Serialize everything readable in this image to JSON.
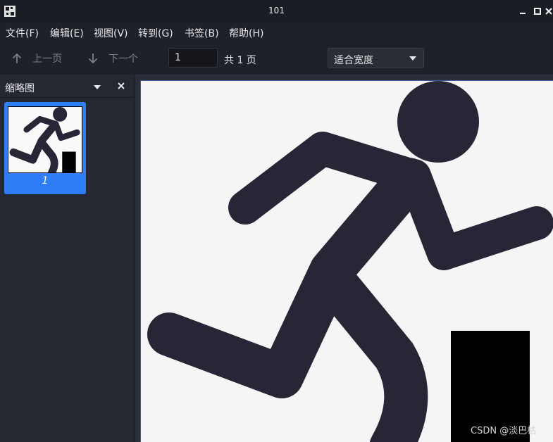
{
  "window": {
    "title": "101"
  },
  "menu": [
    {
      "label": "文件(F)"
    },
    {
      "label": "编辑(E)"
    },
    {
      "label": "视图(V)"
    },
    {
      "label": "转到(G)"
    },
    {
      "label": "书签(B)"
    },
    {
      "label": "帮助(H)"
    }
  ],
  "toolbar": {
    "prev_label": "上一页",
    "next_label": "下一个",
    "page_value": "1",
    "page_total": "共 1 页",
    "zoom_value": "适合宽度"
  },
  "sidebar": {
    "title": "缩略图",
    "thumbnails": [
      {
        "label": "1"
      }
    ]
  },
  "watermark": "CSDN @淡巴枯",
  "colors": {
    "accent": "#2f7ef7",
    "figure": "#262636",
    "page_bg": "#f5f5f5"
  }
}
